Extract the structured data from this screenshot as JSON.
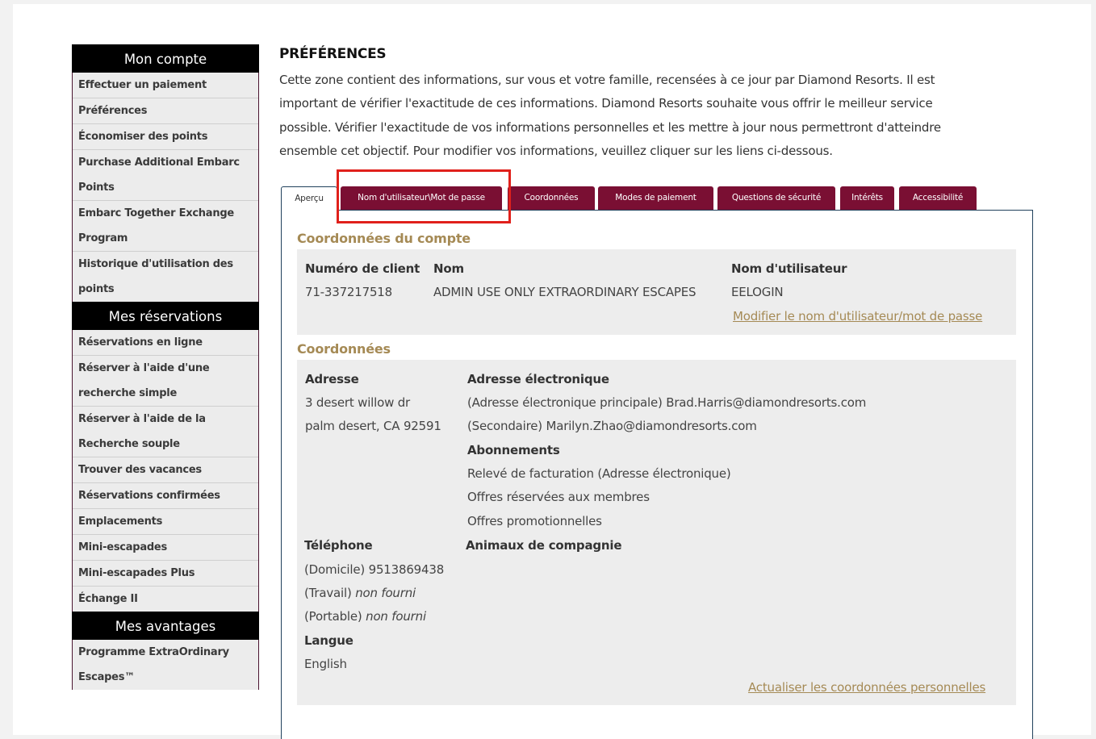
{
  "sidebar": {
    "sections": [
      {
        "title": "Mon compte",
        "items": [
          "Effectuer un paiement",
          "Préférences",
          "Économiser des points",
          "Purchase Additional Embarc",
          "Points",
          "Embarc Together Exchange",
          "Program",
          "Historique d'utilisation des",
          "points"
        ]
      },
      {
        "title": "Mes réservations",
        "items": [
          "Réservations en ligne",
          "Réserver à l'aide d'une",
          "recherche simple",
          "Réserver à l'aide de la",
          "Recherche souple",
          "Trouver des vacances",
          "Réservations confirmées",
          "Emplacements",
          "Mini-escapades",
          "Mini-escapades Plus",
          "Échange II"
        ]
      },
      {
        "title": "Mes avantages",
        "items": [
          "Programme ExtraOrdinary",
          "Escapes™"
        ]
      }
    ]
  },
  "main": {
    "title": "PRÉFÉRENCES",
    "intro_lines": [
      "Cette zone contient des informations, sur vous et votre famille, recensées à ce jour par Diamond Resorts. Il est",
      "important de vérifier l'exactitude de ces informations. Diamond Resorts souhaite vous offrir le meilleur service",
      "possible. Vérifier l'exactitude de vos informations personnelles et les mettre à jour nous permettront d'atteindre",
      "ensemble cet objectif. Pour modifier vos informations, veuillez cliquer sur les liens ci-dessous."
    ]
  },
  "tabs": [
    "Aperçu",
    "Nom d'utilisateur\\Mot de passe",
    "Coordonnées",
    "Modes de paiement",
    "Questions de sécurité",
    "Intérêts",
    "Accessibilité"
  ],
  "account": {
    "section_title": "Coordonnées du compte",
    "client_number_label": "Numéro de client",
    "client_number": "71-337217518",
    "name_label": "Nom",
    "name": "ADMIN USE ONLY EXTRAORDINARY ESCAPES",
    "username_label": "Nom d'utilisateur",
    "username": "EELOGIN",
    "modify_link": "Modifier le nom d'utilisateur/mot de passe"
  },
  "contact": {
    "section_title": "Coordonnées",
    "address_label": "Adresse",
    "address_line1": "3 desert willow dr",
    "address_line2": "palm desert, CA 92591",
    "email_label": "Adresse électronique",
    "email_primary": "(Adresse électronique principale) Brad.Harris@diamondresorts.com",
    "email_secondary": "(Secondaire) Marilyn.Zhao@diamondresorts.com",
    "subscriptions_label": "Abonnements",
    "subscriptions": [
      "Relevé de facturation (Adresse électronique)",
      "Offres réservées aux membres",
      "Offres promotionnelles"
    ],
    "phone_label": "Téléphone",
    "phone_home_prefix": "(Domicile)",
    "phone_home": "9513869438",
    "phone_work_prefix": "(Travail)",
    "phone_work": "non fourni",
    "phone_mobile_prefix": "(Portable)",
    "phone_mobile": "non fourni",
    "pets_label": "Animaux de compagnie",
    "language_label": "Langue",
    "language": "English",
    "update_link": "Actualiser les coordonnées personnelles"
  },
  "colors": {
    "tab_bg": "#7a0f33",
    "accent_gold": "#a58a55",
    "highlight_red": "#e0201b",
    "panel_border": "#20415c"
  }
}
